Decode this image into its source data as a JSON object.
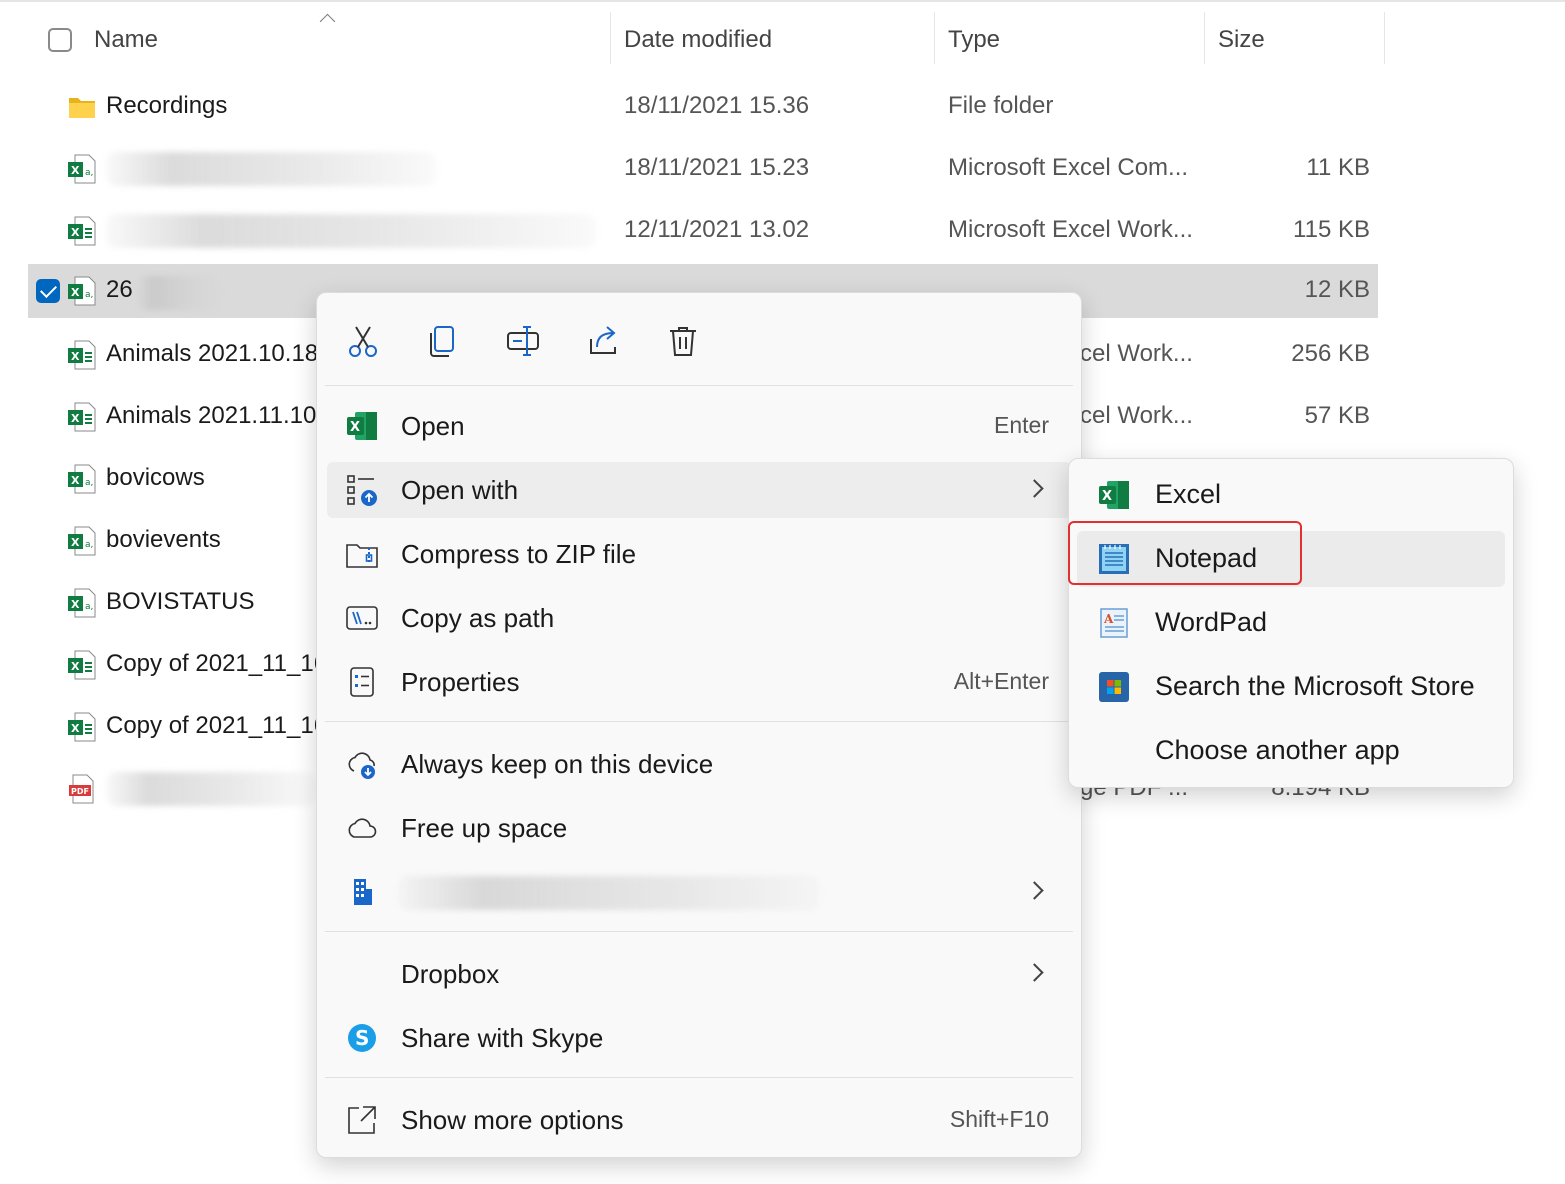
{
  "columns": {
    "name": "Name",
    "date": "Date modified",
    "type": "Type",
    "size": "Size"
  },
  "files": [
    {
      "name": "Recordings",
      "date": "18/11/2021 15.36",
      "type": "File folder",
      "size": ""
    },
    {
      "name": "",
      "date": "18/11/2021 15.23",
      "type": "Microsoft Excel Com...",
      "size": "11 KB"
    },
    {
      "name": "",
      "date": "12/11/2021 13.02",
      "type": "Microsoft Excel Work...",
      "size": "115 KB"
    },
    {
      "name": "26",
      "date": "",
      "type": "",
      "size": "12 KB"
    },
    {
      "name": "Animals 2021.10.18",
      "date": "",
      "type": "cel Work...",
      "size": "256 KB"
    },
    {
      "name": "Animals 2021.11.10",
      "date": "",
      "type": "cel Work...",
      "size": "57 KB"
    },
    {
      "name": "bovicows",
      "date": "",
      "type": "",
      "size": ""
    },
    {
      "name": "bovievents",
      "date": "",
      "type": "",
      "size": ""
    },
    {
      "name": "BOVISTATUS",
      "date": "",
      "type": "",
      "size": ""
    },
    {
      "name": "Copy of 2021_11_16",
      "date": "",
      "type": "",
      "size": ""
    },
    {
      "name": "Copy of 2021_11_16",
      "date": "",
      "type": "",
      "size": ""
    },
    {
      "name": "",
      "date": "",
      "type": "ge PDF ...",
      "size": "8.194 KB"
    }
  ],
  "context_menu": {
    "toolbar": [
      "cut-icon",
      "copy-icon",
      "rename-icon",
      "share-icon",
      "delete-icon"
    ],
    "open": {
      "label": "Open",
      "shortcut": "Enter"
    },
    "open_with": {
      "label": "Open with"
    },
    "compress": {
      "label": "Compress to ZIP file"
    },
    "copy_path": {
      "label": "Copy as path"
    },
    "properties": {
      "label": "Properties",
      "shortcut": "Alt+Enter"
    },
    "always_keep": {
      "label": "Always keep on this device"
    },
    "free_space": {
      "label": "Free up space"
    },
    "dropbox": {
      "label": "Dropbox"
    },
    "skype": {
      "label": "Share with Skype"
    },
    "more_options": {
      "label": "Show more options",
      "shortcut": "Shift+F10"
    }
  },
  "open_with_menu": {
    "items": [
      "Excel",
      "Notepad",
      "WordPad",
      "Search the Microsoft Store",
      "Choose another app"
    ]
  },
  "colors": {
    "accent": "#0067c0",
    "excel_green": "#107c41",
    "highlight_red": "#e23030",
    "selected_row": "#dadada"
  }
}
